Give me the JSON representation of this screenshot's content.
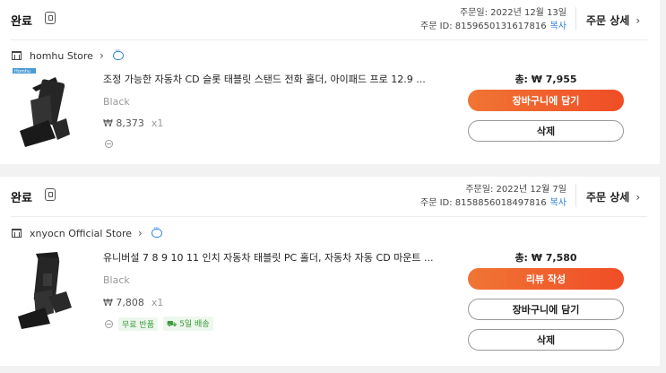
{
  "orders": [
    {
      "status": "완료",
      "order_date": "주문일: 2022년 12월 13일",
      "order_id_label": "주문 ID: 8159650131617816",
      "copy_label": "복사",
      "detail_label": "주문 상세",
      "store_name": "homhu Store",
      "product_title": "조정 가능한 자동차 CD 슬롯 태블릿 스탠드 전화 홀더, 아이패드 프로 12.9 ...",
      "thumb_brand": "Homhu",
      "variant": "Black",
      "unit_price": "₩ 8,373",
      "quantity": "x1",
      "total": "총: ₩ 7,955",
      "buttons": [
        "장바구니에 담기",
        "삭제"
      ]
    },
    {
      "status": "완료",
      "order_date": "주문일: 2022년 12월 7일",
      "order_id_label": "주문 ID: 8158856018497816",
      "copy_label": "복사",
      "detail_label": "주문 상세",
      "store_name": "xnyocn Official Store",
      "product_title": "유니버설 7 8 9 10 11 인치 자동차 태블릿 PC 홀더, 자동차 자동 CD 마운트 ...",
      "variant": "Black",
      "unit_price": "₩ 7,808",
      "quantity": "x1",
      "tags": [
        "무료 반품",
        "5일 배송"
      ],
      "total": "총: ₩ 7,580",
      "buttons": [
        "리뷰 작성",
        "장바구니에 담기",
        "삭제"
      ]
    }
  ],
  "colors": {
    "accent": "#f05a28",
    "link": "#2b7fd9",
    "tag_green": "#3a9a3a"
  }
}
